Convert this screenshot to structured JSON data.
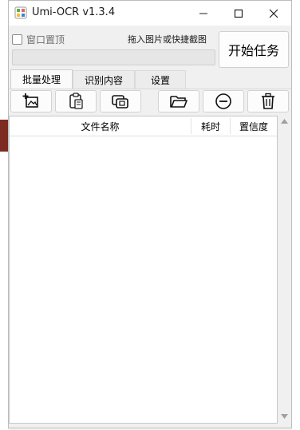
{
  "window": {
    "title": "Umi-OCR v1.3.4"
  },
  "options": {
    "pin_window_label": "窗口置顶",
    "pin_window_checked": false,
    "drop_hint": "拖入图片或快捷截图",
    "progress_percent": 0,
    "start_button": "开始任务"
  },
  "tabs": [
    {
      "label": "批量处理",
      "active": true
    },
    {
      "label": "识别内容",
      "active": false
    },
    {
      "label": "设置",
      "active": false
    }
  ],
  "toolbar": {
    "buttons": [
      {
        "icon": "add-image-icon"
      },
      {
        "icon": "paste-icon"
      },
      {
        "icon": "screenshot-icon"
      },
      {
        "icon": "folder-icon"
      },
      {
        "icon": "remove-icon"
      },
      {
        "icon": "trash-icon"
      }
    ]
  },
  "table": {
    "columns": [
      "文件名称",
      "耗时",
      "置信度"
    ],
    "rows": []
  }
}
